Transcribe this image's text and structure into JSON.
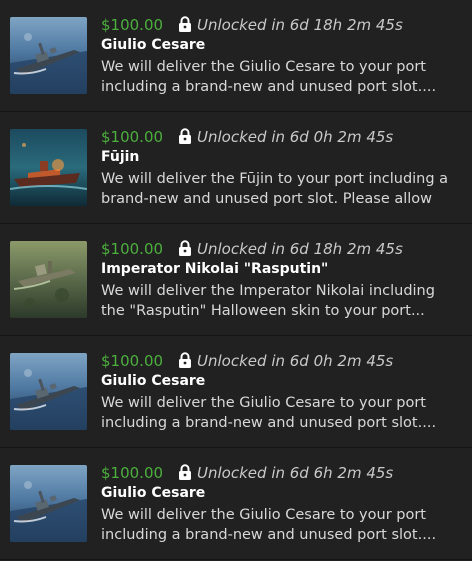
{
  "items": [
    {
      "price": "$100.00",
      "lock_icon": "lock-icon",
      "unlock_text": "Unlocked in 6d 18h 2m 45s",
      "title": "Giulio Cesare",
      "description_line1": "We will deliver the Giulio Cesare to your port",
      "description_line2": "including a brand-new and unused port slot....",
      "thumbnail": "ship-thumbnail"
    },
    {
      "price": "$100.00",
      "lock_icon": "lock-icon",
      "unlock_text": "Unlocked in 6d 0h 2m 45s",
      "title": "Fūjin",
      "description_line1": "We will deliver the Fūjin to your port including a",
      "description_line2": "brand-new and unused port slot. Please allow u...",
      "thumbnail": "ship-thumbnail"
    },
    {
      "price": "$100.00",
      "lock_icon": "lock-icon",
      "unlock_text": "Unlocked in 6d 18h 2m 45s",
      "title": "Imperator Nikolai \"Rasputin\"",
      "description_line1": "We will deliver the Imperator Nikolai including",
      "description_line2": "the \"Rasputin\" Halloween skin to your port...",
      "thumbnail": "ship-thumbnail"
    },
    {
      "price": "$100.00",
      "lock_icon": "lock-icon",
      "unlock_text": "Unlocked in 6d 0h 2m 45s",
      "title": "Giulio Cesare",
      "description_line1": "We will deliver the Giulio Cesare to your port",
      "description_line2": "including a brand-new and unused port slot....",
      "thumbnail": "ship-thumbnail"
    },
    {
      "price": "$100.00",
      "lock_icon": "lock-icon",
      "unlock_text": "Unlocked in 6d 6h 2m 45s",
      "title": "Giulio Cesare",
      "description_line1": "We will deliver the Giulio Cesare to your port",
      "description_line2": "including a brand-new and unused port slot....",
      "thumbnail": "ship-thumbnail"
    }
  ]
}
